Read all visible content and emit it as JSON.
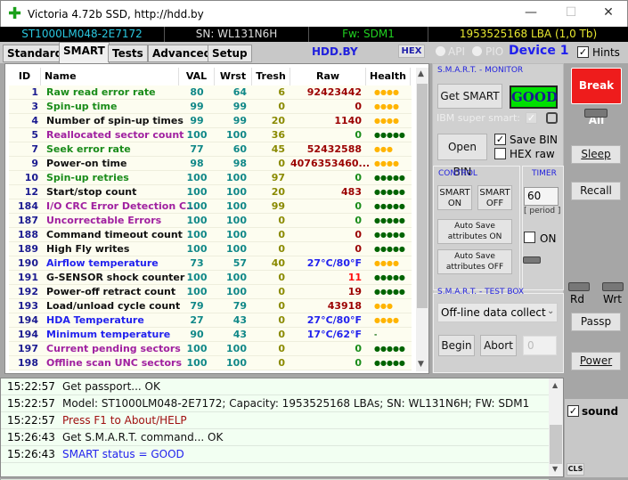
{
  "window": {
    "title": "Victoria 4.72b SSD, http://hdd.by",
    "icon": "green-cross-icon",
    "minimize": "—",
    "maximize": "☐",
    "close": "✕"
  },
  "infobar": {
    "model": "ST1000LM048-2E7172",
    "serial": "SN: WL131N6H",
    "firmware": "Fw: SDM1",
    "capacity": "1953525168 LBA (1,0 Tb)"
  },
  "tabs": [
    "Standard",
    "SMART",
    "Tests",
    "Advanced",
    "Setup"
  ],
  "active_tab": "SMART",
  "toolbar": {
    "site": "HDD.BY",
    "hex": "HEX",
    "api": "API",
    "pio": "PIO",
    "device": "Device 1",
    "hints": "Hints",
    "hints_checked": true
  },
  "table": {
    "columns": [
      "ID",
      "Name",
      "VAL",
      "Wrst",
      "Tresh",
      "Raw",
      "Health"
    ],
    "rows": [
      {
        "id": "1",
        "name": "Raw read error rate",
        "val": "80",
        "wrst": "64",
        "tresh": "6",
        "raw": "92423442",
        "health": "●●●●",
        "nc": "#1a8c1a",
        "rc": "#9b0000",
        "hc": "#ffb400"
      },
      {
        "id": "3",
        "name": "Spin-up time",
        "val": "99",
        "wrst": "99",
        "tresh": "0",
        "raw": "0",
        "health": "●●●●",
        "nc": "#1a8c1a",
        "rc": "#9b0000",
        "hc": "#ffb400"
      },
      {
        "id": "4",
        "name": "Number of spin-up times",
        "val": "99",
        "wrst": "99",
        "tresh": "20",
        "raw": "1140",
        "health": "●●●●",
        "nc": "#111111",
        "rc": "#9b0000",
        "hc": "#ffb400"
      },
      {
        "id": "5",
        "name": "Reallocated sector count",
        "val": "100",
        "wrst": "100",
        "tresh": "36",
        "raw": "0",
        "health": "●●●●●",
        "nc": "#a020a0",
        "rc": "#1a8c1a",
        "hc": "#006400"
      },
      {
        "id": "7",
        "name": "Seek error rate",
        "val": "77",
        "wrst": "60",
        "tresh": "45",
        "raw": "52432588",
        "health": "●●●",
        "nc": "#1a8c1a",
        "rc": "#9b0000",
        "hc": "#ffb400"
      },
      {
        "id": "9",
        "name": "Power-on time",
        "val": "98",
        "wrst": "98",
        "tresh": "0",
        "raw": "4076353460...",
        "health": "●●●●",
        "nc": "#111111",
        "rc": "#9b0000",
        "hc": "#ffb400"
      },
      {
        "id": "10",
        "name": "Spin-up retries",
        "val": "100",
        "wrst": "100",
        "tresh": "97",
        "raw": "0",
        "health": "●●●●●",
        "nc": "#1a8c1a",
        "rc": "#1a8c1a",
        "hc": "#006400"
      },
      {
        "id": "12",
        "name": "Start/stop count",
        "val": "100",
        "wrst": "100",
        "tresh": "20",
        "raw": "483",
        "health": "●●●●●",
        "nc": "#111111",
        "rc": "#9b0000",
        "hc": "#006400"
      },
      {
        "id": "184",
        "name": "I/O CRC Error Detection C...",
        "val": "100",
        "wrst": "100",
        "tresh": "99",
        "raw": "0",
        "health": "●●●●●",
        "nc": "#a020a0",
        "rc": "#1a8c1a",
        "hc": "#006400"
      },
      {
        "id": "187",
        "name": "Uncorrectable Errors",
        "val": "100",
        "wrst": "100",
        "tresh": "0",
        "raw": "0",
        "health": "●●●●●",
        "nc": "#a020a0",
        "rc": "#1a8c1a",
        "hc": "#006400"
      },
      {
        "id": "188",
        "name": "Command timeout count",
        "val": "100",
        "wrst": "100",
        "tresh": "0",
        "raw": "0",
        "health": "●●●●●",
        "nc": "#111111",
        "rc": "#9b0000",
        "hc": "#006400"
      },
      {
        "id": "189",
        "name": "High Fly writes",
        "val": "100",
        "wrst": "100",
        "tresh": "0",
        "raw": "0",
        "health": "●●●●●",
        "nc": "#111111",
        "rc": "#9b0000",
        "hc": "#006400"
      },
      {
        "id": "190",
        "name": "Airflow temperature",
        "val": "73",
        "wrst": "57",
        "tresh": "40",
        "raw": "27°C/80°F",
        "health": "●●●●",
        "nc": "#2222ee",
        "rc": "#2222ee",
        "hc": "#ffb400"
      },
      {
        "id": "191",
        "name": "G-SENSOR shock counter",
        "val": "100",
        "wrst": "100",
        "tresh": "0",
        "raw": "11",
        "health": "●●●●●",
        "nc": "#111111",
        "rc": "#ff1010",
        "hc": "#006400"
      },
      {
        "id": "192",
        "name": "Power-off retract count",
        "val": "100",
        "wrst": "100",
        "tresh": "0",
        "raw": "19",
        "health": "●●●●●",
        "nc": "#111111",
        "rc": "#9b0000",
        "hc": "#006400"
      },
      {
        "id": "193",
        "name": "Load/unload cycle count",
        "val": "79",
        "wrst": "79",
        "tresh": "0",
        "raw": "43918",
        "health": "●●●",
        "nc": "#111111",
        "rc": "#9b0000",
        "hc": "#ffb400"
      },
      {
        "id": "194",
        "name": "HDA Temperature",
        "val": "27",
        "wrst": "43",
        "tresh": "0",
        "raw": "27°C/80°F",
        "health": "●●●●",
        "nc": "#2222ee",
        "rc": "#2222ee",
        "hc": "#ffb400"
      },
      {
        "id": "194",
        "name": "Minimum temperature",
        "val": "90",
        "wrst": "43",
        "tresh": "0",
        "raw": "17°C/62°F",
        "health": "-",
        "nc": "#2222ee",
        "rc": "#2222ee",
        "hc": "#006400"
      },
      {
        "id": "197",
        "name": "Current pending sectors",
        "val": "100",
        "wrst": "100",
        "tresh": "0",
        "raw": "0",
        "health": "●●●●●",
        "nc": "#a020a0",
        "rc": "#1a8c1a",
        "hc": "#006400"
      },
      {
        "id": "198",
        "name": "Offline scan UNC sectors",
        "val": "100",
        "wrst": "100",
        "tresh": "0",
        "raw": "0",
        "health": "●●●●●",
        "nc": "#a020a0",
        "rc": "#1a8c1a",
        "hc": "#006400"
      }
    ]
  },
  "monitor": {
    "title": "S.M.A.R.T. - MONITOR",
    "get_smart": "Get SMART",
    "status": "GOOD",
    "status_color": "#00e000",
    "ibm": "IBM super smart:",
    "open_bin": "Open BIN",
    "save_bin": "Save BIN",
    "save_bin_checked": true,
    "hex_raw": "HEX raw",
    "hex_raw_checked": false
  },
  "control": {
    "title": "CONTROL",
    "smart_on": "SMART ON",
    "smart_off": "SMART OFF",
    "autosave_on": "Auto Save attributes ON",
    "autosave_off": "Auto Save attributes OFF"
  },
  "timer": {
    "title": "TIMER",
    "value": "60",
    "period": "[ period ]",
    "on": "ON",
    "on_checked": false
  },
  "testbox": {
    "title": "S.M.A.R.T. - TEST BOX",
    "selected": "Off-line data collect",
    "begin": "Begin",
    "abort": "Abort",
    "value": "0"
  },
  "side": {
    "break_all": "Break All",
    "sleep": "Sleep",
    "recall": "Recall",
    "rd": "Rd",
    "wrt": "Wrt",
    "passp": "Passp",
    "power": "Power",
    "sound": "sound",
    "sound_checked": true,
    "cls": "CLS"
  },
  "log": [
    {
      "time": "15:22:57",
      "msg": "Get passport... OK",
      "color": "#111111"
    },
    {
      "time": "15:22:57",
      "msg": "Model: ST1000LM048-2E7172; Capacity: 1953525168 LBAs; SN: WL131N6H; FW: SDM1",
      "color": "#111111"
    },
    {
      "time": "15:22:57",
      "msg": "Press F1 to About/HELP",
      "color": "#a01010"
    },
    {
      "time": "15:26:43",
      "msg": "Get S.M.A.R.T. command... OK",
      "color": "#111111"
    },
    {
      "time": "15:26:43",
      "msg": "SMART status = GOOD",
      "color": "#2222ee"
    }
  ]
}
